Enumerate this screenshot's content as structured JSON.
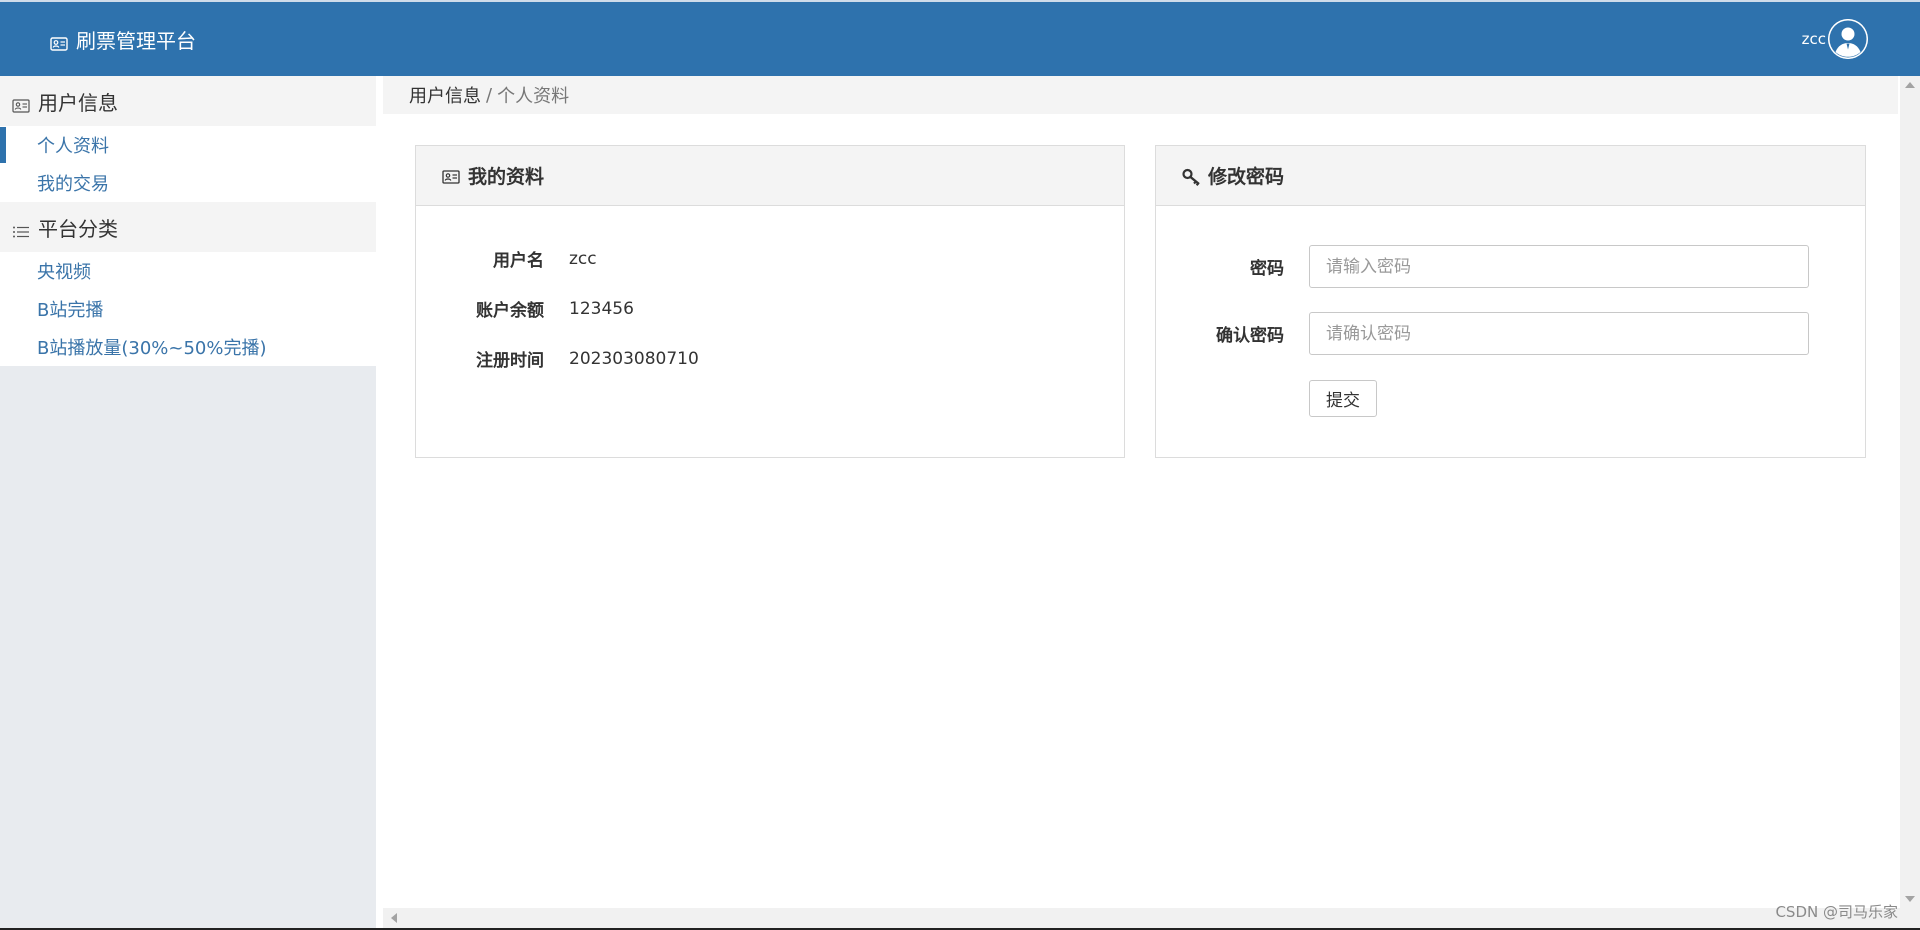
{
  "header": {
    "brand_icon": "id-card-icon",
    "title": "刷票管理平台",
    "username": "zcc",
    "avatar_icon": "user-avatar-icon"
  },
  "sidebar": {
    "groups": [
      {
        "icon": "id-card-icon",
        "title": "用户信息",
        "items": [
          {
            "label": "个人资料",
            "active": true
          },
          {
            "label": "我的交易",
            "active": false
          }
        ]
      },
      {
        "icon": "list-icon",
        "title": "平台分类",
        "items": [
          {
            "label": "央视频",
            "active": false
          },
          {
            "label": "B站完播",
            "active": false
          },
          {
            "label": "B站播放量(30%~50%完播)",
            "active": false
          }
        ]
      }
    ]
  },
  "breadcrumb": {
    "parent": "用户信息",
    "separator": "/",
    "current": "个人资料"
  },
  "profile_panel": {
    "icon": "id-card-icon",
    "title": "我的资料",
    "rows": [
      {
        "label": "用户名",
        "value": "zcc"
      },
      {
        "label": "账户余额",
        "value": "123456"
      },
      {
        "label": "注册时间",
        "value": "202303080710"
      }
    ]
  },
  "password_panel": {
    "icon": "key-icon",
    "title": "修改密码",
    "password_label": "密码",
    "password_placeholder": "请输入密码",
    "password_value": "",
    "confirm_label": "确认密码",
    "confirm_placeholder": "请确认密码",
    "confirm_value": "",
    "submit_label": "提交"
  },
  "watermark": "CSDN @司马乐家",
  "colors": {
    "header_bg": "#2e72ad",
    "link": "#3a74a9",
    "panel_head_bg": "#f4f4f4",
    "sidebar_bg": "#e8ebef"
  }
}
